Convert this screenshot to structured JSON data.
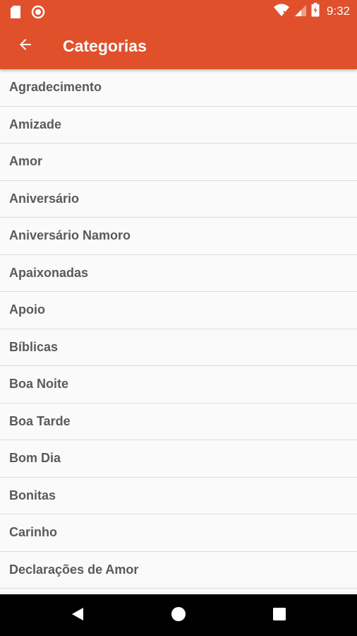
{
  "status_bar": {
    "time": "9:32",
    "icons": [
      "sd-card-icon",
      "record-icon",
      "wifi-icon",
      "signal-icon",
      "battery-charging-icon"
    ]
  },
  "toolbar": {
    "back_icon": "arrow-left-icon",
    "title": "Categorias"
  },
  "colors": {
    "primary": "#e0502b",
    "list_background": "#fafafa",
    "divider": "#dcdcdc",
    "item_text": "#5a5a5a",
    "nav_bar": "#000000"
  },
  "categories": [
    "Agradecimento",
    "Amizade",
    "Amor",
    "Aniversário",
    "Aniversário Namoro",
    "Apaixonadas",
    "Apoio",
    "Bíblicas",
    "Boa Noite",
    "Boa Tarde",
    "Bom Dia",
    "Bonitas",
    "Carinho",
    "Declarações de Amor"
  ],
  "nav_bar": {
    "icons": [
      "back-triangle-icon",
      "home-circle-icon",
      "recents-square-icon"
    ]
  }
}
